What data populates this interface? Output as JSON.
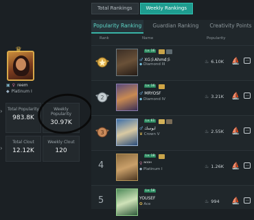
{
  "top_tabs": [
    "Total Rankings",
    "Weekly Rankings"
  ],
  "sub_tabs": [
    "Popularity Ranking",
    "Guardian Ranking",
    "Creativity Points"
  ],
  "columns": {
    "rank": "Rank",
    "name": "Name",
    "popularity": "Popularity"
  },
  "profile": {
    "name": "reem",
    "tier": "Platinum I",
    "total_popularity_label": "Total Popularity",
    "total_popularity": "983.8K",
    "weekly_popularity_label": "Weekly Popularity",
    "weekly_popularity": "30.97K",
    "total_clout_label": "Total Clout",
    "total_clout": "12.12K",
    "weekly_clout_label": "Weekly Clout",
    "weekly_clout": "120"
  },
  "rows": [
    {
      "rank": "",
      "level": "Lv. 16",
      "name": "XG彡Ahmd彡",
      "tier": "Diamond III",
      "popularity": "6.10K"
    },
    {
      "rank": "",
      "level": "Lv. 16",
      "name": "MRYOSF",
      "tier": "Diamond IV",
      "popularity": "3.21K"
    },
    {
      "rank": "",
      "level": "Lv. 61",
      "name": "ايوسك",
      "tier": "Crown V",
      "popularity": "2.55K"
    },
    {
      "rank": "4",
      "level": "Lv. 18",
      "name": "ᴺᴼᴰᴴ",
      "tier": "Platinum I",
      "popularity": "1.26K"
    },
    {
      "rank": "5",
      "level": "Lv. 58",
      "name": "YOUSEF",
      "tier": "Ace",
      "popularity": "994"
    }
  ],
  "action_icons": [
    "gift-icon",
    "more-icon"
  ],
  "more_glyph": "···"
}
